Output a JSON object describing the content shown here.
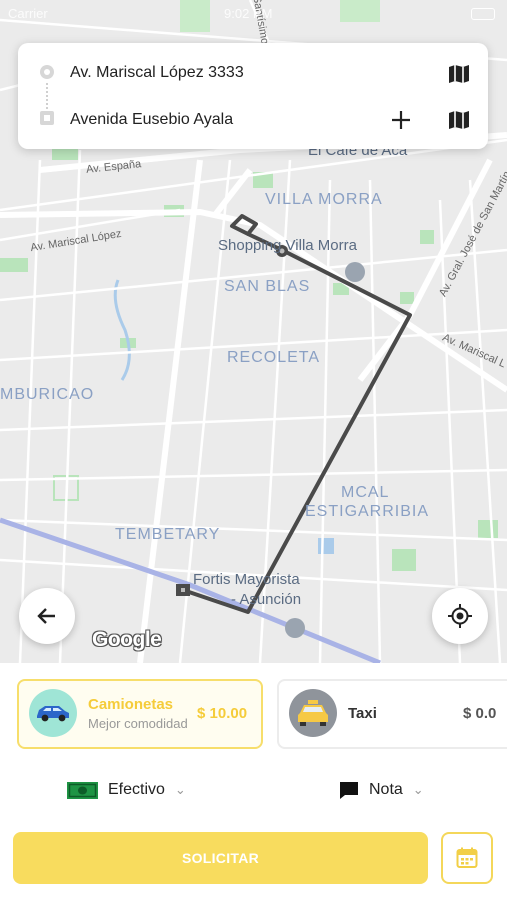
{
  "status_bar": {
    "carrier": "Carrier",
    "time": "9:02 PM"
  },
  "route": {
    "origin": "Av. Mariscal López 3333",
    "destination": "Avenida Eusebio Ayala"
  },
  "map": {
    "areas": [
      "VILLA MORRA",
      "SAN BLAS",
      "RECOLETA",
      "MBURICAO",
      "MCAL",
      "ESTIGARRIBIA",
      "TEMBETARY"
    ],
    "streets": [
      "Av. España",
      "Av. Mariscal López",
      "Av. Gral. José de San Martín",
      "Av. Mariscal L",
      "Santísimo"
    ],
    "pois": [
      "El Café de Acá",
      "Shopping Villa Morra",
      "Fortis Mayorista",
      "- Asunción"
    ],
    "attribution": "Google"
  },
  "vehicles": [
    {
      "name": "Camionetas",
      "description": "Mejor comodidad",
      "price": "$ 10.00",
      "selected": true,
      "icon": "suv-icon"
    },
    {
      "name": "Taxi",
      "description": "",
      "price": "$ 0.0",
      "selected": false,
      "icon": "taxi-icon"
    }
  ],
  "payment": {
    "label": "Efectivo",
    "icon": "cash-icon"
  },
  "note": {
    "label": "Nota",
    "icon": "comment-icon"
  },
  "request_button": "SOLICITAR",
  "colors": {
    "accent": "#f8dc5e",
    "route": "#4a4a4a",
    "map_bg": "#ebebeb",
    "area_label": "#8aa0c4"
  }
}
